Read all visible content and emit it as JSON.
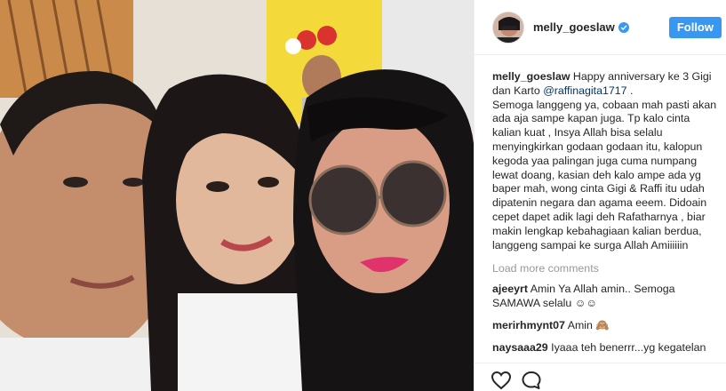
{
  "post": {
    "username": "melly_goeslaw",
    "follow_label": "Follow",
    "caption": {
      "author": "melly_goeslaw",
      "text_before_mention": " Happy anniversary ke 3 Gigi dan Karto ",
      "mention": "@raffinagita1717",
      "text_after_mention": " .",
      "body": "Semoga langgeng ya, cobaan mah pasti akan ada aja sampe kapan juga. Tp kalo cinta kalian kuat , Insya Allah bisa selalu menyingkirkan godaan godaan itu, kalopun kegoda yaa palingan juga cuma numpang lewat doang, kasian deh kalo ampe ada yg baper mah, wong cinta Gigi & Raffi itu udah dipatenin negara dan agama eeem. Didoain cepet dapet adik lagi deh Rafatharnya , biar makin lengkap kebahagiaan kalian berdua, langgeng sampai ke surga Allah Amiiiiiin"
    },
    "load_more_label": "Load more comments",
    "comments": [
      {
        "author": "ajeeyrt",
        "text": " Amin Ya Allah amin.. Semoga SAMAWA selalu ☺☺"
      },
      {
        "author": "merirhmynt07",
        "text": " Amin 🙈"
      },
      {
        "author": "naysaaa29",
        "text": " Iyaaa teh benerrr...yg kegatelan"
      }
    ]
  },
  "colors": {
    "accent": "#3897f0",
    "text": "#262626",
    "muted": "#999999",
    "mention": "#003569"
  },
  "icons": {
    "verified": "verified-badge-icon",
    "like": "heart-outline-icon",
    "comment": "speech-bubble-icon"
  }
}
